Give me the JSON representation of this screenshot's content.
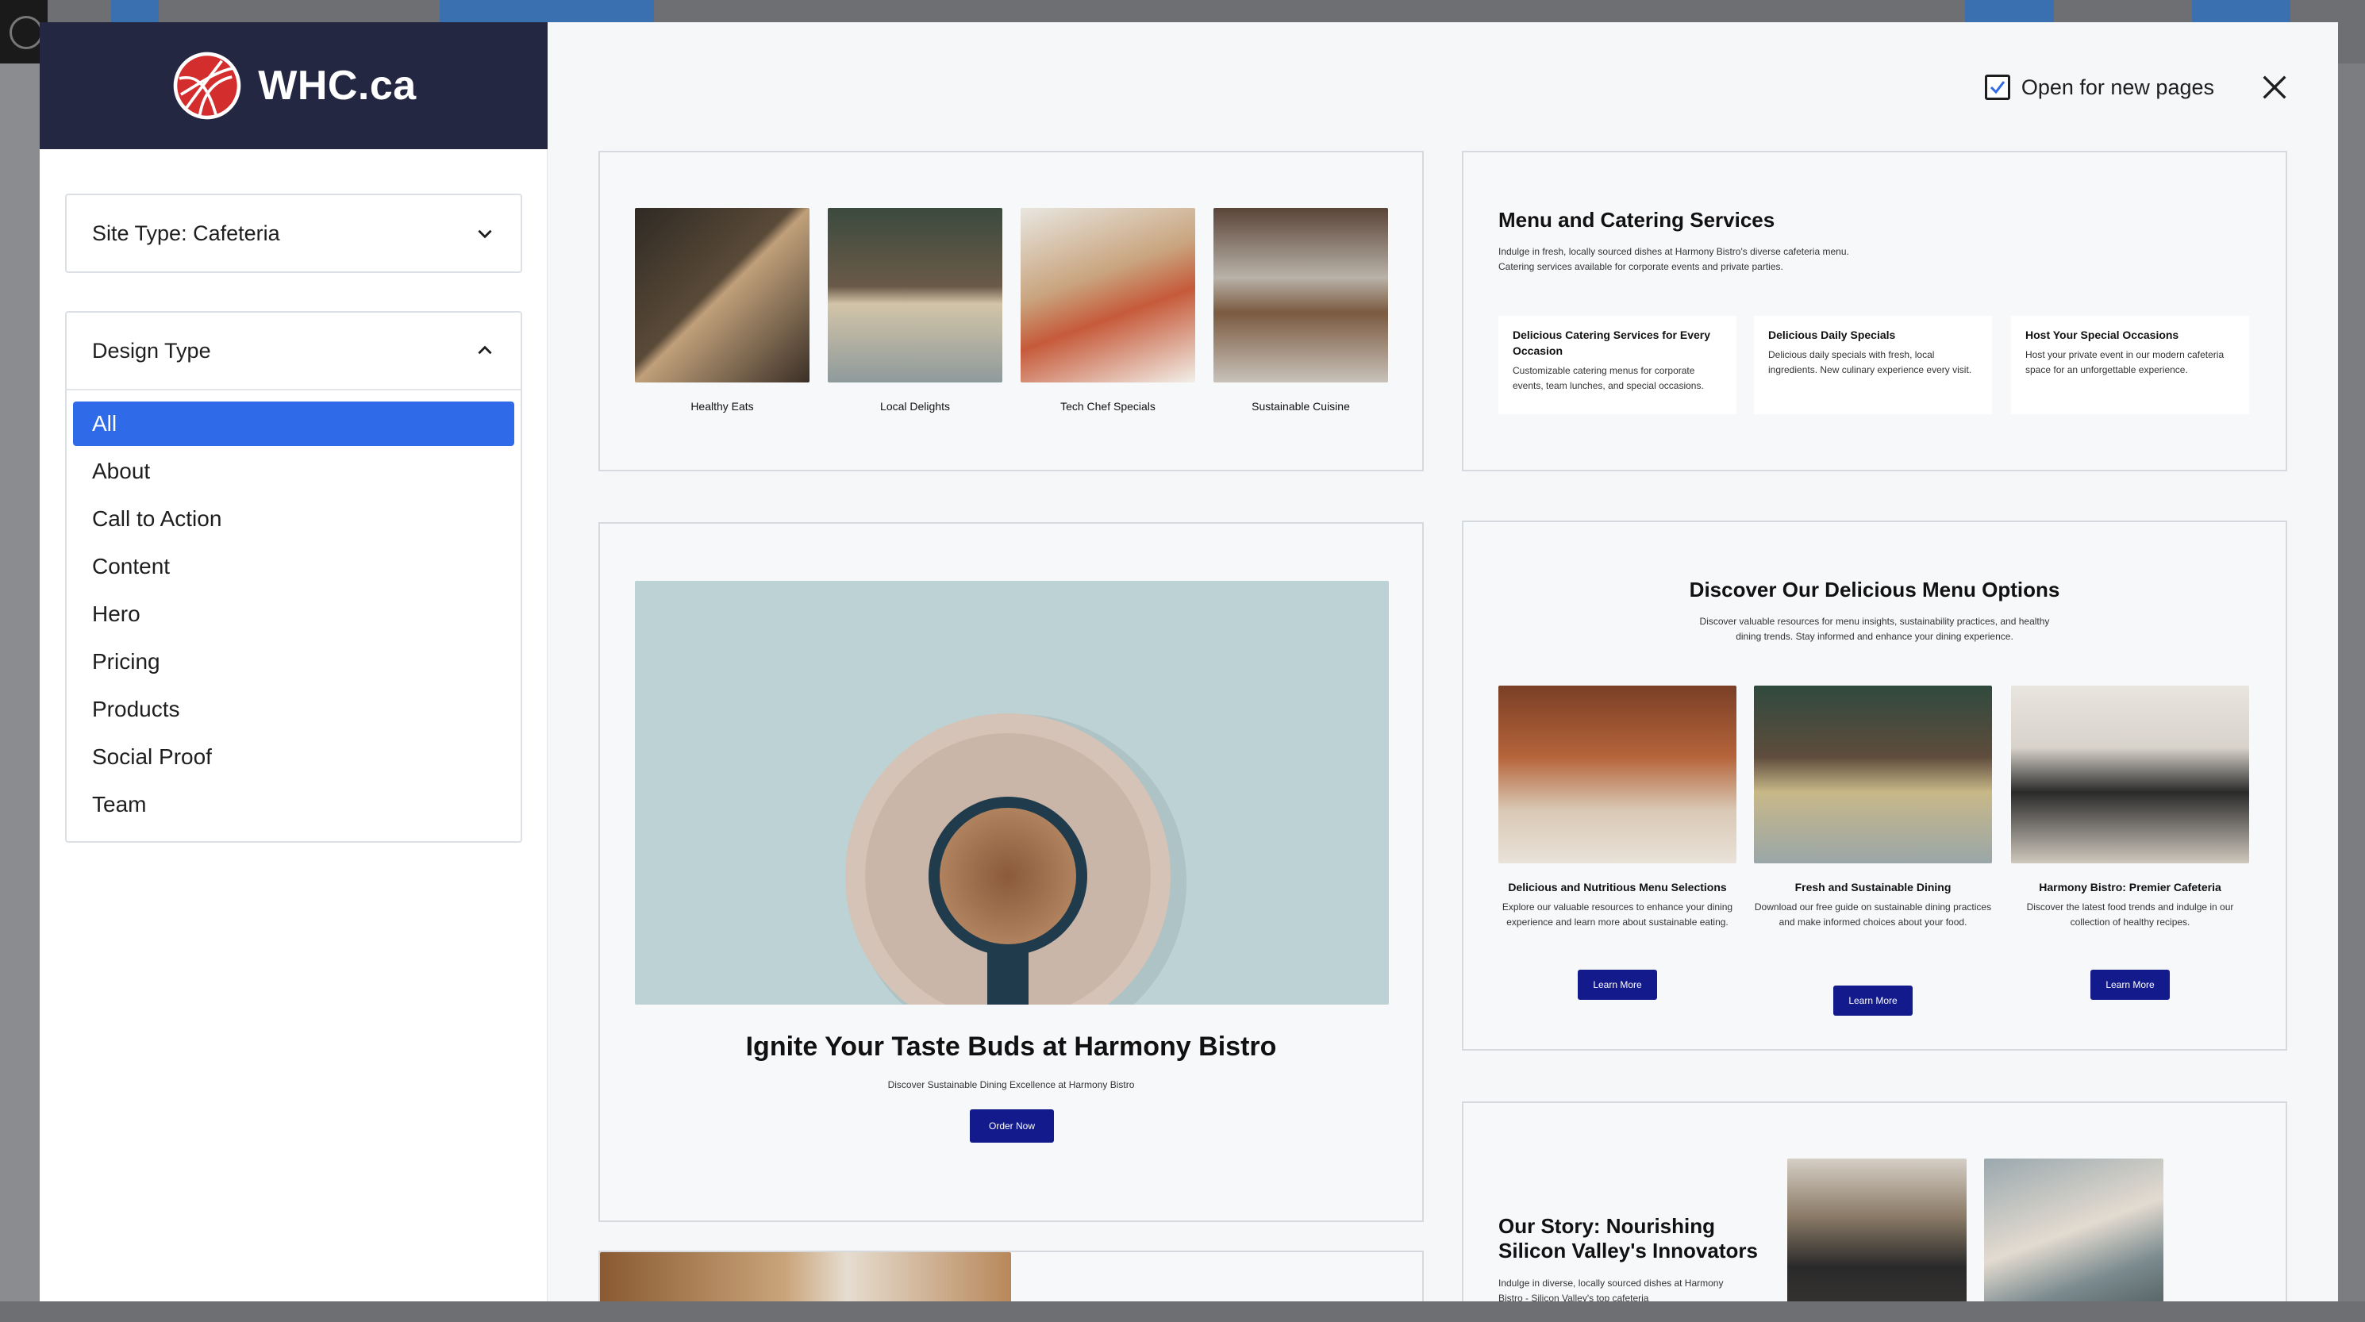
{
  "header": {
    "brand_name": "WHC.ca",
    "open_for_new_pages_label": "Open for new pages",
    "open_for_new_pages_checked": true
  },
  "sidebar": {
    "site_type_label": "Site Type: Cafeteria",
    "design_type_label": "Design Type",
    "design_types": [
      "All",
      "About",
      "Call to Action",
      "Content",
      "Hero",
      "Pricing",
      "Products",
      "Social Proof",
      "Team"
    ],
    "selected": "All"
  },
  "patterns": {
    "gallery": {
      "captions": [
        "Healthy Eats",
        "Local Delights",
        "Tech Chef Specials",
        "Sustainable Cuisine"
      ]
    },
    "catering": {
      "title": "Menu and Catering Services",
      "intro": "Indulge in fresh, locally sourced dishes at Harmony Bistro's diverse cafeteria menu. Catering services available for corporate events and private parties.",
      "items": [
        {
          "title": "Delicious Catering Services for Every Occasion",
          "text": "Customizable catering menus for corporate events, team lunches, and special occasions."
        },
        {
          "title": "Delicious Daily Specials",
          "text": "Delicious daily specials with fresh, local ingredients. New culinary experience every visit."
        },
        {
          "title": "Host Your Special Occasions",
          "text": "Host your private event in our modern cafeteria space for an unforgettable experience."
        }
      ]
    },
    "hero": {
      "title": "Ignite Your Taste Buds at Harmony Bistro",
      "subtitle": "Discover Sustainable Dining Excellence at Harmony Bistro",
      "button": "Order Now"
    },
    "menu_options": {
      "title": "Discover Our Delicious Menu Options",
      "intro": "Discover valuable resources for menu insights, sustainability practices, and healthy dining trends. Stay informed and enhance your dining experience.",
      "items": [
        {
          "title": "Delicious and Nutritious Menu Selections",
          "text": "Explore our valuable resources to enhance your dining experience and learn more about sustainable eating.",
          "button": "Learn More"
        },
        {
          "title": "Fresh and Sustainable Dining",
          "text": "Download our free guide on sustainable dining practices and make informed choices about your food.",
          "button": "Learn More"
        },
        {
          "title": "Harmony Bistro: Premier Cafeteria",
          "text": "Discover the latest food trends and indulge in our collection of healthy recipes.",
          "button": "Learn More"
        }
      ]
    },
    "story": {
      "title": "Our Story: Nourishing Silicon Valley's Innovators",
      "intro": "Indulge in diverse, locally sourced dishes at Harmony Bistro - Silicon Valley's top cafeteria"
    }
  }
}
